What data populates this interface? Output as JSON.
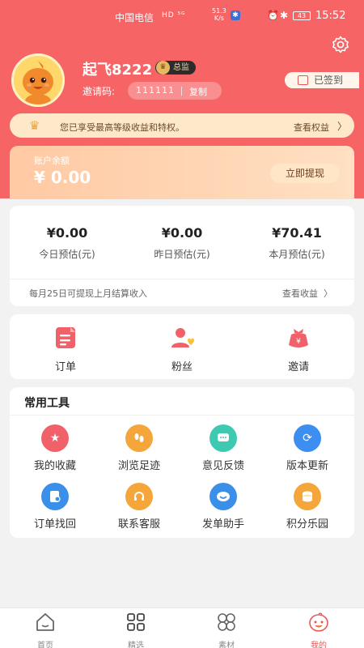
{
  "status_bar": {
    "carrier": "中国电信",
    "network": "HD ⁵ᴳ",
    "speed": "51.3\nK/s",
    "battery": "43",
    "time": "15:52"
  },
  "profile": {
    "username": "起飞8222",
    "role": "总监",
    "invite_label": "邀请码:",
    "invite_code": "111111",
    "copy_label": "复制",
    "signin_label": "已签到"
  },
  "vip_bar": {
    "text": "您已享受最高等级收益和特权。",
    "link": "查看权益"
  },
  "balance": {
    "label": "账户余额",
    "amount": "¥ 0.00",
    "withdraw_label": "立即提现"
  },
  "earnings": {
    "items": [
      {
        "value": "¥0.00",
        "label": "今日预估(元)"
      },
      {
        "value": "¥0.00",
        "label": "昨日预估(元)"
      },
      {
        "value": "¥70.41",
        "label": "本月预估(元)"
      }
    ],
    "note": "每月25日可提现上月结算收入",
    "view_link": "查看收益"
  },
  "quick_links": [
    {
      "label": "订单",
      "icon": "order-icon"
    },
    {
      "label": "粉丝",
      "icon": "fans-icon"
    },
    {
      "label": "邀请",
      "icon": "invite-icon"
    }
  ],
  "tools": {
    "title": "常用工具",
    "items": [
      {
        "label": "我的收藏",
        "icon": "star-icon",
        "color": "#f0616a"
      },
      {
        "label": "浏览足迹",
        "icon": "footprint-icon",
        "color": "#f5a63b"
      },
      {
        "label": "意见反馈",
        "icon": "feedback-icon",
        "color": "#3ec9b3"
      },
      {
        "label": "版本更新",
        "icon": "refresh-icon",
        "color": "#3c8ef0"
      },
      {
        "label": "订单找回",
        "icon": "order-retrieve-icon",
        "color": "#3a8fe8"
      },
      {
        "label": "联系客服",
        "icon": "headset-icon",
        "color": "#f5a63b"
      },
      {
        "label": "发单助手",
        "icon": "assistant-icon",
        "color": "#3a8fe8"
      },
      {
        "label": "积分乐园",
        "icon": "coins-icon",
        "color": "#f5a63b"
      }
    ]
  },
  "tabbar": [
    {
      "label": "首页",
      "icon": "home-icon"
    },
    {
      "label": "精选",
      "icon": "grid-icon"
    },
    {
      "label": "素材",
      "icon": "material-icon"
    },
    {
      "label": "我的",
      "icon": "mascot-icon",
      "active": true
    }
  ],
  "colors": {
    "brand_red": "#f76466",
    "accent_gold": "#fde9c9",
    "active_tab": "#e85757"
  }
}
